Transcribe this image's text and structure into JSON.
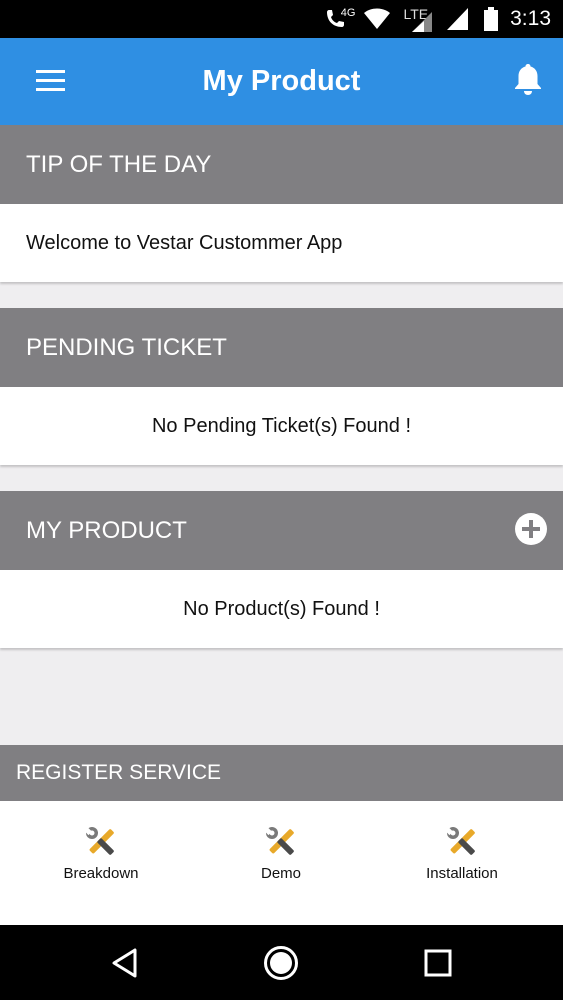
{
  "status_bar": {
    "network_label": "4G",
    "lte_label": "LTE",
    "time": "3:13"
  },
  "app_bar": {
    "title": "My Product",
    "color": "#2f8fe3"
  },
  "tip_of_the_day": {
    "header": "TIP OF THE DAY",
    "message": "Welcome to Vestar Custommer App"
  },
  "pending_ticket": {
    "header": "PENDING TICKET",
    "message": "No Pending Ticket(s) Found !"
  },
  "my_product": {
    "header": "MY PRODUCT",
    "message": "No Product(s) Found !"
  },
  "register_service": {
    "header": "REGISTER SERVICE",
    "items": [
      {
        "label": "Breakdown",
        "icon": "tools-icon"
      },
      {
        "label": "Demo",
        "icon": "tools-icon"
      },
      {
        "label": "Installation",
        "icon": "tools-icon"
      }
    ]
  },
  "colors": {
    "section_header": "#807f82",
    "background": "#efeef0"
  }
}
